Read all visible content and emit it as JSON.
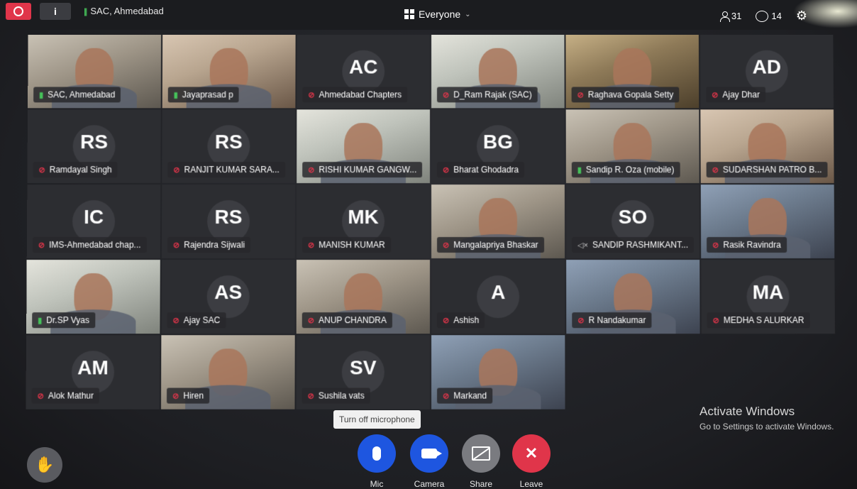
{
  "topbar": {
    "title": "SAC, Ahmedabad",
    "view_label": "Everyone",
    "participants_count": "31",
    "chat_count": "14"
  },
  "tiles": [
    {
      "name": "SAC, Ahmedabad",
      "mic": "on",
      "video": true,
      "initials": ""
    },
    {
      "name": "Jayaprasad p",
      "mic": "on",
      "video": true,
      "initials": ""
    },
    {
      "name": "Ahmedabad Chapters",
      "mic": "off",
      "video": false,
      "initials": "AC"
    },
    {
      "name": "D_Ram Rajak (SAC)",
      "mic": "off",
      "video": true,
      "initials": ""
    },
    {
      "name": "Raghava Gopala Setty",
      "mic": "off",
      "video": true,
      "initials": ""
    },
    {
      "name": "Ajay Dhar",
      "mic": "off",
      "video": false,
      "initials": "AD"
    },
    {
      "name": "Ramdayal Singh",
      "mic": "off",
      "video": false,
      "initials": "RS"
    },
    {
      "name": "RANJIT KUMAR SARA...",
      "mic": "off",
      "video": false,
      "initials": "RS"
    },
    {
      "name": "RISHI KUMAR GANGW...",
      "mic": "off",
      "video": true,
      "initials": ""
    },
    {
      "name": "Bharat Ghodadra",
      "mic": "off",
      "video": false,
      "initials": "BG"
    },
    {
      "name": "Sandip R. Oza (mobile)",
      "mic": "on",
      "video": true,
      "initials": ""
    },
    {
      "name": "SUDARSHAN PATRO B...",
      "mic": "off",
      "video": true,
      "initials": ""
    },
    {
      "name": "IMS-Ahmedabad chap...",
      "mic": "off",
      "video": false,
      "initials": "IC"
    },
    {
      "name": "Rajendra Sijwali",
      "mic": "off",
      "video": false,
      "initials": "RS"
    },
    {
      "name": "MANISH KUMAR",
      "mic": "off",
      "video": false,
      "initials": "MK"
    },
    {
      "name": "Mangalapriya Bhaskar",
      "mic": "off",
      "video": true,
      "initials": ""
    },
    {
      "name": "SANDIP RASHMIKANT...",
      "mic": "speaker-off",
      "video": false,
      "initials": "SO"
    },
    {
      "name": "Rasik Ravindra",
      "mic": "off",
      "video": true,
      "initials": ""
    },
    {
      "name": "Dr.SP Vyas",
      "mic": "on",
      "video": true,
      "initials": ""
    },
    {
      "name": "Ajay SAC",
      "mic": "off",
      "video": false,
      "initials": "AS"
    },
    {
      "name": "ANUP CHANDRA",
      "mic": "off",
      "video": true,
      "initials": ""
    },
    {
      "name": "Ashish",
      "mic": "off",
      "video": false,
      "initials": "A"
    },
    {
      "name": "R Nandakumar",
      "mic": "off",
      "video": true,
      "initials": ""
    },
    {
      "name": "MEDHA S ALURKAR",
      "mic": "off",
      "video": false,
      "initials": "MA"
    },
    {
      "name": "Alok Mathur",
      "mic": "off",
      "video": false,
      "initials": "AM"
    },
    {
      "name": "Hiren",
      "mic": "off",
      "video": true,
      "initials": ""
    },
    {
      "name": "Sushila vats",
      "mic": "off",
      "video": false,
      "initials": "SV"
    },
    {
      "name": "Markand",
      "mic": "off",
      "video": true,
      "initials": ""
    }
  ],
  "activation": {
    "title": "Activate Windows",
    "subtitle": "Go to Settings to activate Windows."
  },
  "controls": {
    "tooltip": "Turn off microphone",
    "mic_label": "Mic",
    "camera_label": "Camera",
    "share_label": "Share",
    "leave_label": "Leave"
  },
  "colors": {
    "accent_blue": "#1e56e0",
    "leave_red": "#e0354a",
    "mic_on_green": "#46c25a"
  }
}
